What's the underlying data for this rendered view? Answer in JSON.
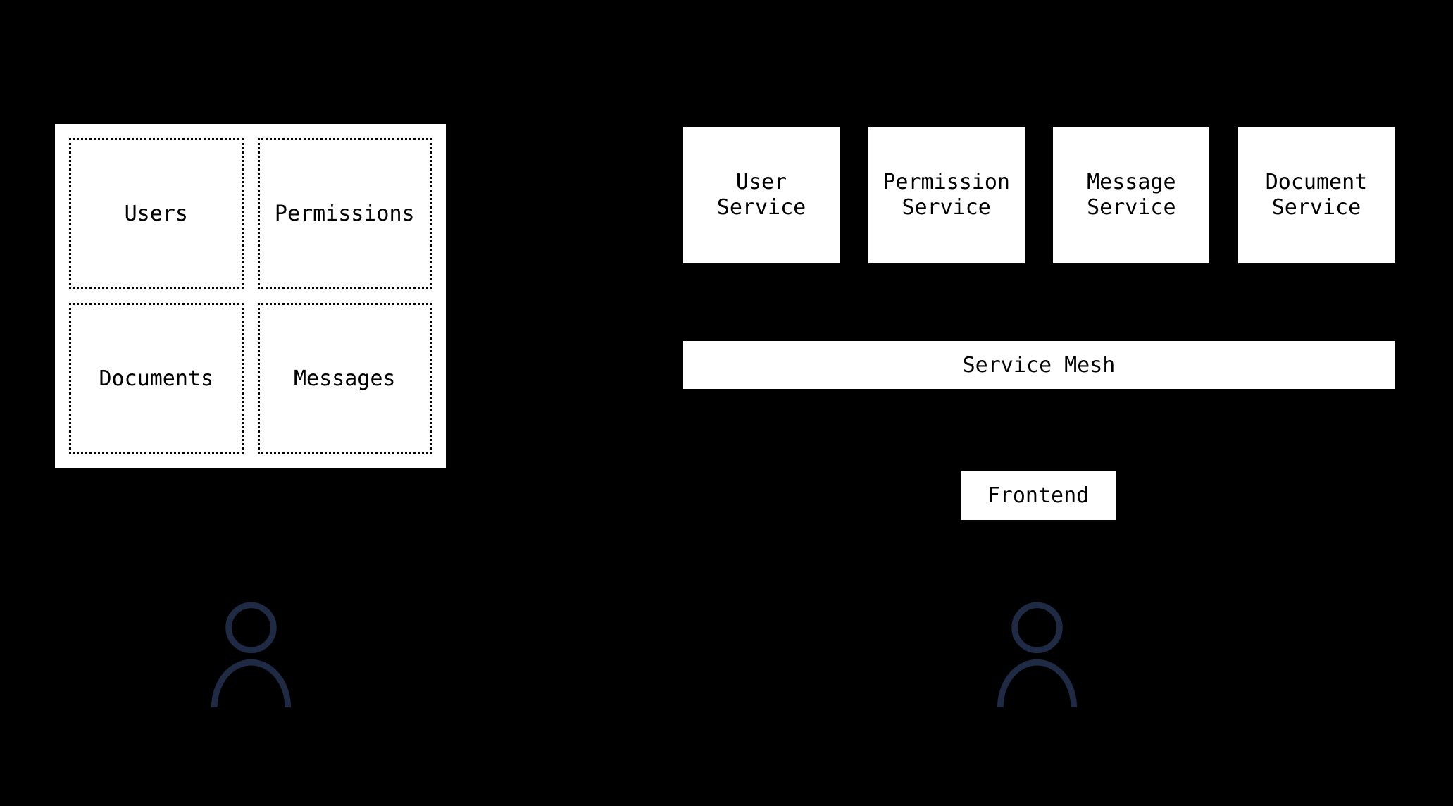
{
  "monolith": {
    "modules": {
      "users": "Users",
      "permissions": "Permissions",
      "documents": "Documents",
      "messages": "Messages"
    }
  },
  "microservices": {
    "services": {
      "user": "User Service",
      "permission": "Permission Service",
      "message": "Message Service",
      "document": "Document Service"
    },
    "mesh": "Service Mesh",
    "frontend": "Frontend"
  }
}
